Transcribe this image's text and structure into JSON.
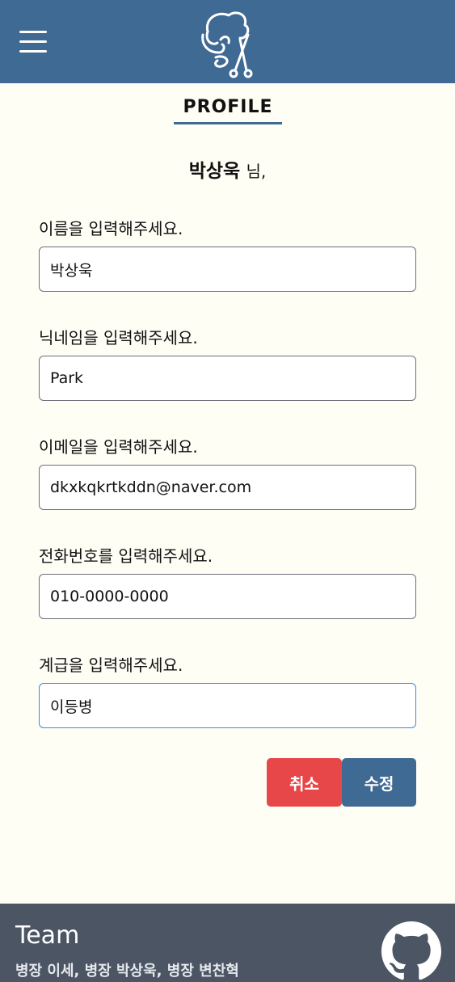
{
  "header": {
    "menu_icon": "hamburger-menu-icon",
    "logo_icon": "stylized-hair-scissors-logo-icon",
    "background_color": "#3f6a93"
  },
  "page": {
    "title": "PROFILE",
    "greeting": {
      "user_name": "박상욱",
      "honorific": "님,"
    }
  },
  "form": {
    "fields": [
      {
        "label": "이름을 입력해주세요.",
        "value": "박상욱"
      },
      {
        "label": "닉네임을 입력해주세요.",
        "value": "Park"
      },
      {
        "label": "이메일을 입력해주세요.",
        "value": "dkxkqkrtkddn@naver.com"
      },
      {
        "label": "전화번호를 입력해주세요.",
        "value": "010-0000-0000"
      },
      {
        "label": "계급을 입력해주세요.",
        "value": "이등병"
      }
    ],
    "cancel_label": "취소",
    "submit_label": "수정",
    "cancel_color": "#e8474a",
    "submit_color": "#3f6a93"
  },
  "footer": {
    "title": "Team",
    "members": "병장 이세, 병장 박상욱, 병장 변찬혁",
    "github_icon": "github-icon",
    "background_color": "#4b5563"
  }
}
